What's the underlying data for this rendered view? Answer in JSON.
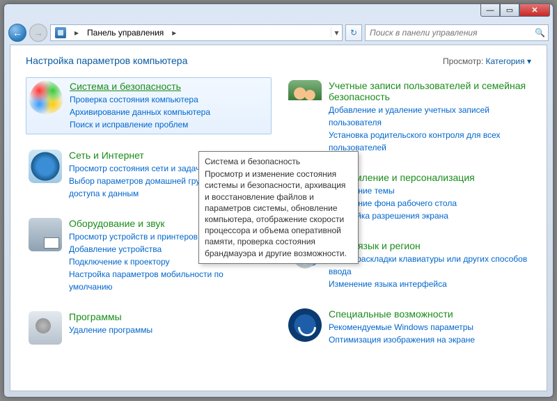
{
  "window": {
    "min_glyph": "—",
    "max_glyph": "▭",
    "close_glyph": "✕"
  },
  "nav": {
    "back_glyph": "←",
    "fwd_glyph": "→",
    "breadcrumb": "Панель управления",
    "breadcrumb_sep": "▸",
    "dropdown_glyph": "▾",
    "refresh_glyph": "↻"
  },
  "search": {
    "placeholder": "Поиск в панели управления",
    "icon_glyph": "🔍"
  },
  "header": {
    "title": "Настройка параметров компьютера",
    "view_label": "Просмотр:",
    "view_value": "Категория",
    "view_caret": "▾"
  },
  "tooltip": {
    "title": "Система и безопасность",
    "body": "Просмотр и изменение состояния системы и безопасности, архивация и восстановление файлов и параметров системы, обновление компьютера, отображение скорости процессора и объема оперативной памяти, проверка состояния брандмауэра и другие возможности."
  },
  "left": [
    {
      "title": "Система и безопасность",
      "selected": true,
      "links": [
        "Проверка состояния компьютера",
        "Архивирование данных компьютера",
        "Поиск и исправление проблем"
      ]
    },
    {
      "title": "Сеть и Интернет",
      "links": [
        "Просмотр состояния сети и задач",
        "Выбор параметров домашней группы и общего доступа к данным"
      ]
    },
    {
      "title": "Оборудование и звук",
      "links": [
        "Просмотр устройств и принтеров",
        "Добавление устройства",
        "Подключение к проектору",
        "Настройка параметров мобильности по умолчанию"
      ]
    },
    {
      "title": "Программы",
      "links": [
        "Удаление программы"
      ]
    }
  ],
  "right": [
    {
      "title": "Учетные записи пользователей и семейная безопасность",
      "links": [
        "Добавление и удаление учетных записей пользователя",
        "Установка родительского контроля для всех пользователей"
      ]
    },
    {
      "title": "Оформление и персонализация",
      "links": [
        "Изменение темы",
        "Изменение фона рабочего стола",
        "Настройка разрешения экрана"
      ]
    },
    {
      "title": "Часы, язык и регион",
      "links": [
        "Смена раскладки клавиатуры или других способов ввода",
        "Изменение языка интерфейса"
      ]
    },
    {
      "title": "Специальные возможности",
      "links": [
        "Рекомендуемые Windows параметры",
        "Оптимизация изображения на экране"
      ]
    }
  ]
}
